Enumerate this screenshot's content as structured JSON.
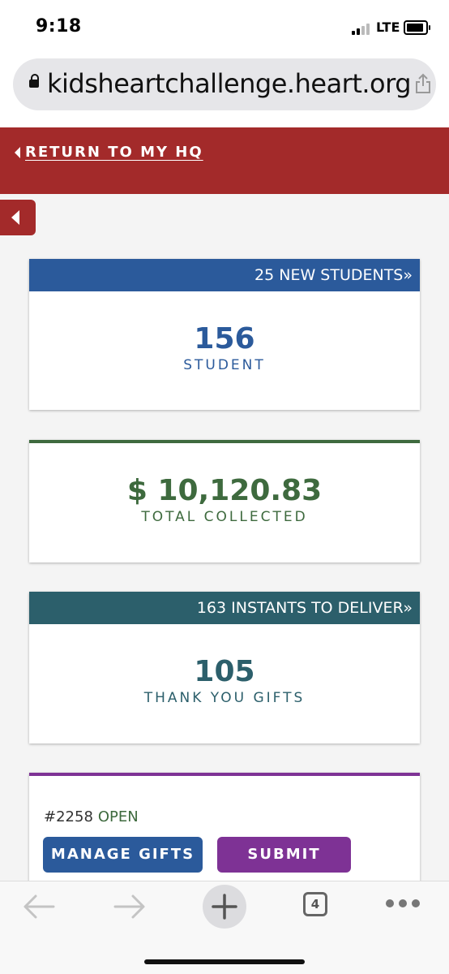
{
  "status_bar": {
    "time": "9:18",
    "network": "LTE"
  },
  "browser": {
    "url": "kidsheartchallenge.heart.org"
  },
  "banner": {
    "return_label": "RETURN TO MY HQ"
  },
  "cards": {
    "students": {
      "header": "25 NEW STUDENTS»",
      "value": "156",
      "label": "STUDENT"
    },
    "collected": {
      "value": "$ 10,120.83",
      "label": "TOTAL COLLECTED"
    },
    "gifts": {
      "header": "163 INSTANTS TO DELIVER»",
      "value": "105",
      "label": "THANK YOU GIFTS"
    },
    "order": {
      "number": "#2258",
      "status": "OPEN",
      "manage_label": "MANAGE GIFTS",
      "submit_label": "SUBMIT"
    }
  },
  "toolbar": {
    "tab_count": "4"
  },
  "colors": {
    "brand_red": "#a32a2a",
    "blue": "#2b5a9b",
    "green": "#3e6a3e",
    "teal": "#2c5f6b",
    "purple": "#7e3295"
  }
}
